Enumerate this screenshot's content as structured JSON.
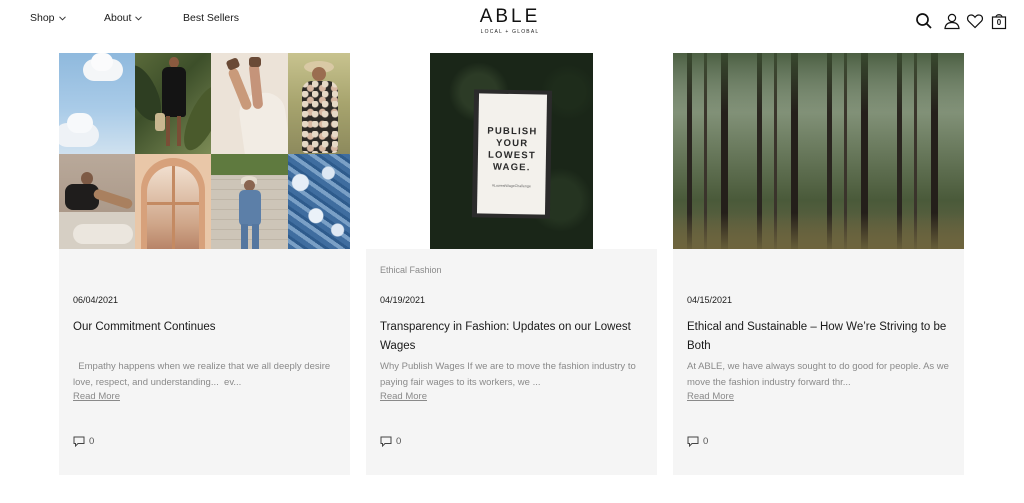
{
  "nav": {
    "items": [
      {
        "label": "Shop"
      },
      {
        "label": "About"
      },
      {
        "label": "Best Sellers"
      }
    ]
  },
  "logo": {
    "main": "ABLE",
    "sub": "LOCAL + GLOBAL"
  },
  "header_icons": [
    "search-icon",
    "account-icon",
    "wishlist-heart-icon",
    "cart-bag-icon"
  ],
  "cart_count": "0",
  "posts": [
    {
      "category": "",
      "date": "06/04/2021",
      "title": "Our Commitment Continues",
      "excerpt": "  Empathy happens when we realize that we all deeply desire love, respect, and understanding...  ev...",
      "read_more": "Read More",
      "comments": "0"
    },
    {
      "category": "Ethical Fashion",
      "date": "04/19/2021",
      "title": "Transparency in Fashion: Updates on our Lowest Wages",
      "excerpt": "Why Publish Wages If we are to move the fashion industry to paying fair wages to its workers, we ...",
      "read_more": "Read More",
      "comments": "0",
      "image_text": [
        "PUBLISH",
        "YOUR",
        "LOWEST",
        "WAGE."
      ],
      "image_hashtag": "#LowestWageChallenge"
    },
    {
      "category": "",
      "date": "04/15/2021",
      "title": "Ethical and Sustainable – How We’re Striving to be Both",
      "excerpt": "At ABLE, we have always sought to do good for people. As we move the fashion industry forward thr...",
      "read_more": "Read More",
      "comments": "0"
    }
  ]
}
